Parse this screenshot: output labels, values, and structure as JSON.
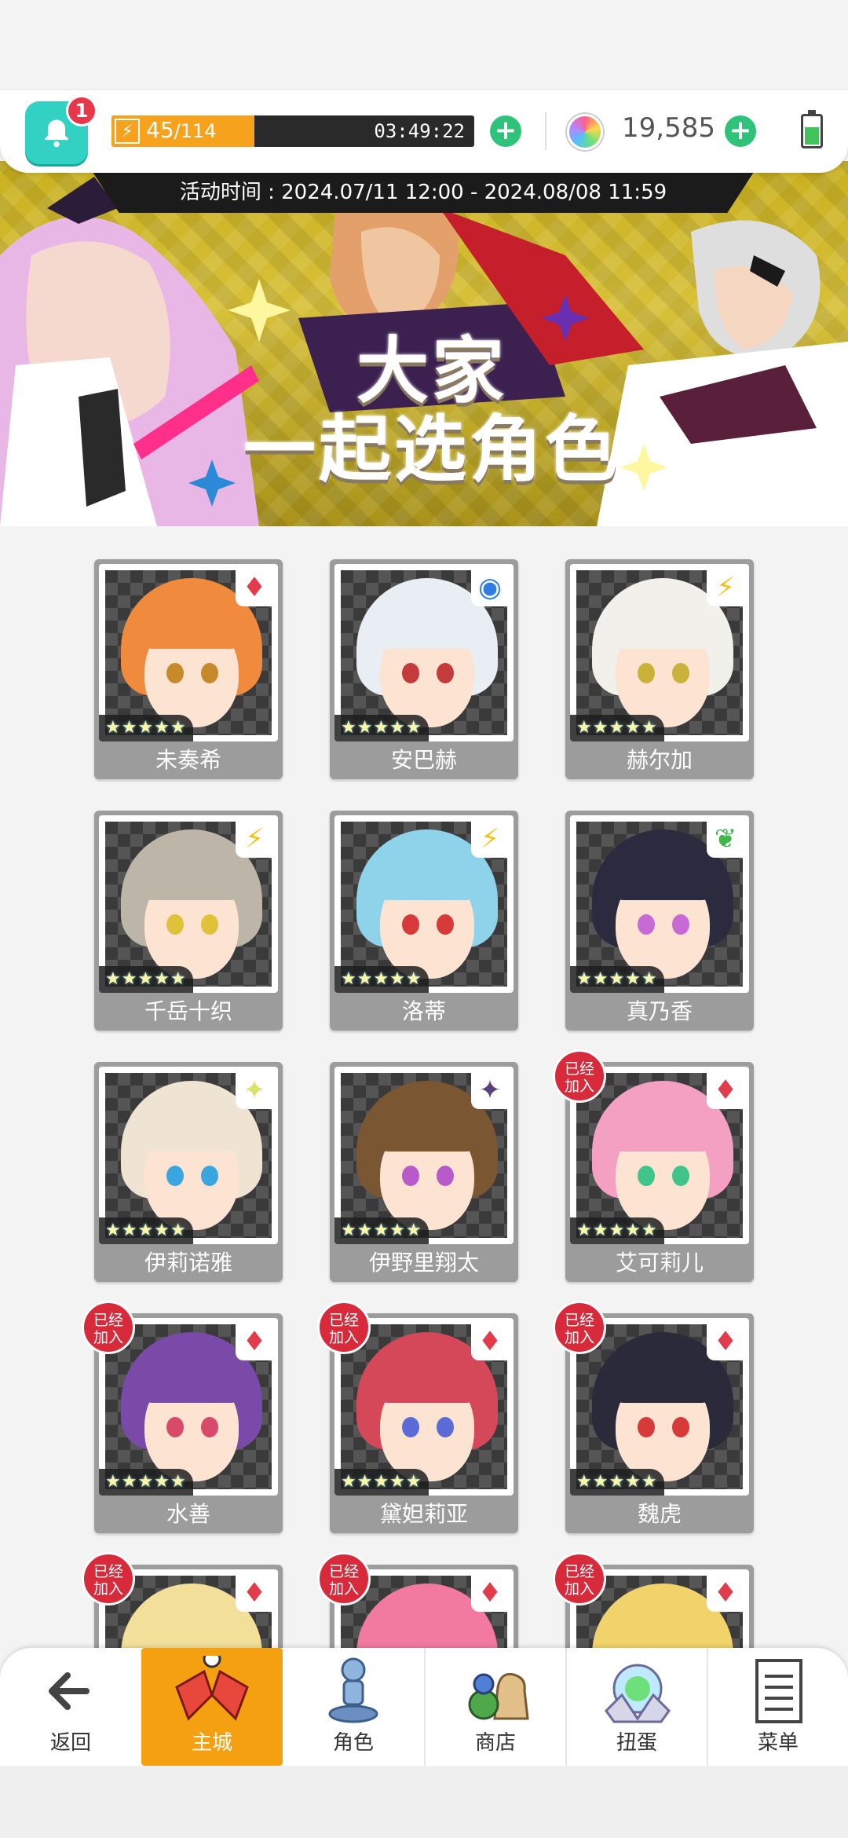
{
  "topbar": {
    "notification_count": "1",
    "stamina_current": "45",
    "stamina_max": "/114",
    "stamina_fraction": 0.395,
    "stamina_timer": "03:49:22",
    "gem_count": "19,585"
  },
  "banner": {
    "event_time": "活动时间 : 2024.07/11 12:00 - 2024.08/08 11:59",
    "title_line1": "大家",
    "title_line2": "一起选角色"
  },
  "characters": [
    {
      "name": "未奏希",
      "stars": "★★★★★",
      "attr_icon": "fire-icon",
      "attr_glyph": "♦",
      "attr_color": "#e23b4c",
      "hair": "#f08a3c",
      "eye": "#c78a2a",
      "joined": false
    },
    {
      "name": "安巴赫",
      "stars": "★★★★★",
      "attr_icon": "water-icon",
      "attr_glyph": "◉",
      "attr_color": "#2f7de1",
      "hair": "#e9eef5",
      "eye": "#c43b3b",
      "joined": false
    },
    {
      "name": "赫尔加",
      "stars": "★★★★★",
      "attr_icon": "lightning-icon",
      "attr_glyph": "⚡",
      "attr_color": "#f2c21b",
      "hair": "#f2f0ea",
      "eye": "#c9b23a",
      "joined": false
    },
    {
      "name": "千岳十织",
      "stars": "★★★★★",
      "attr_icon": "lightning-icon",
      "attr_glyph": "⚡",
      "attr_color": "#f2c21b",
      "hair": "#bdb6a8",
      "eye": "#e0c23a",
      "joined": false
    },
    {
      "name": "洛蒂",
      "stars": "★★★★★",
      "attr_icon": "lightning-icon",
      "attr_glyph": "⚡",
      "attr_color": "#f2c21b",
      "hair": "#8fd3ea",
      "eye": "#d83a3a",
      "joined": false
    },
    {
      "name": "真乃香",
      "stars": "★★★★★",
      "attr_icon": "leaf-icon",
      "attr_glyph": "❦",
      "attr_color": "#3fb54a",
      "hair": "#2c2a3e",
      "eye": "#c86ad6",
      "joined": false
    },
    {
      "name": "伊莉诺雅",
      "stars": "★★★★★",
      "attr_icon": "light-icon",
      "attr_glyph": "✦",
      "attr_color": "#d9e36a",
      "hair": "#efe3d2",
      "eye": "#3aa6e0",
      "joined": false
    },
    {
      "name": "伊野里翔太",
      "stars": "★★★★★",
      "attr_icon": "dark-icon",
      "attr_glyph": "✦",
      "attr_color": "#5a3f7a",
      "hair": "#7a5632",
      "eye": "#b85ac9",
      "joined": false
    },
    {
      "name": "艾可莉儿",
      "stars": "★★★★★",
      "attr_icon": "fire-icon",
      "attr_glyph": "♦",
      "attr_color": "#e23b4c",
      "hair": "#f4a0c3",
      "eye": "#3fc48a",
      "joined": true
    },
    {
      "name": "水善",
      "stars": "★★★★★",
      "attr_icon": "fire-icon",
      "attr_glyph": "♦",
      "attr_color": "#e23b4c",
      "hair": "#7a4aa8",
      "eye": "#d84a6a",
      "joined": true
    },
    {
      "name": "黛妲莉亚",
      "stars": "★★★★★",
      "attr_icon": "fire-icon",
      "attr_glyph": "♦",
      "attr_color": "#e23b4c",
      "hair": "#d4485a",
      "eye": "#5a6ad6",
      "joined": true
    },
    {
      "name": "魏虎",
      "stars": "★★★★★",
      "attr_icon": "fire-icon",
      "attr_glyph": "♦",
      "attr_color": "#e23b4c",
      "hair": "#2a2a3a",
      "eye": "#d83a3a",
      "joined": true
    },
    {
      "name": "",
      "stars": "",
      "attr_icon": "fire-icon",
      "attr_glyph": "♦",
      "attr_color": "#e23b4c",
      "hair": "#f2df9a",
      "eye": "#6aa0d8",
      "joined": true
    },
    {
      "name": "",
      "stars": "",
      "attr_icon": "fire-icon",
      "attr_glyph": "♦",
      "attr_color": "#e23b4c",
      "hair": "#f27aa0",
      "eye": "#6a8ad8",
      "joined": true
    },
    {
      "name": "",
      "stars": "",
      "attr_icon": "fire-icon",
      "attr_glyph": "♦",
      "attr_color": "#e23b4c",
      "hair": "#f2d26a",
      "eye": "#6aa0d8",
      "joined": true
    }
  ],
  "joined_label": "已经\n加入",
  "nav": {
    "back": "返回",
    "home": "主城",
    "character": "角色",
    "shop": "商店",
    "gacha": "扭蛋",
    "menu": "菜单"
  }
}
